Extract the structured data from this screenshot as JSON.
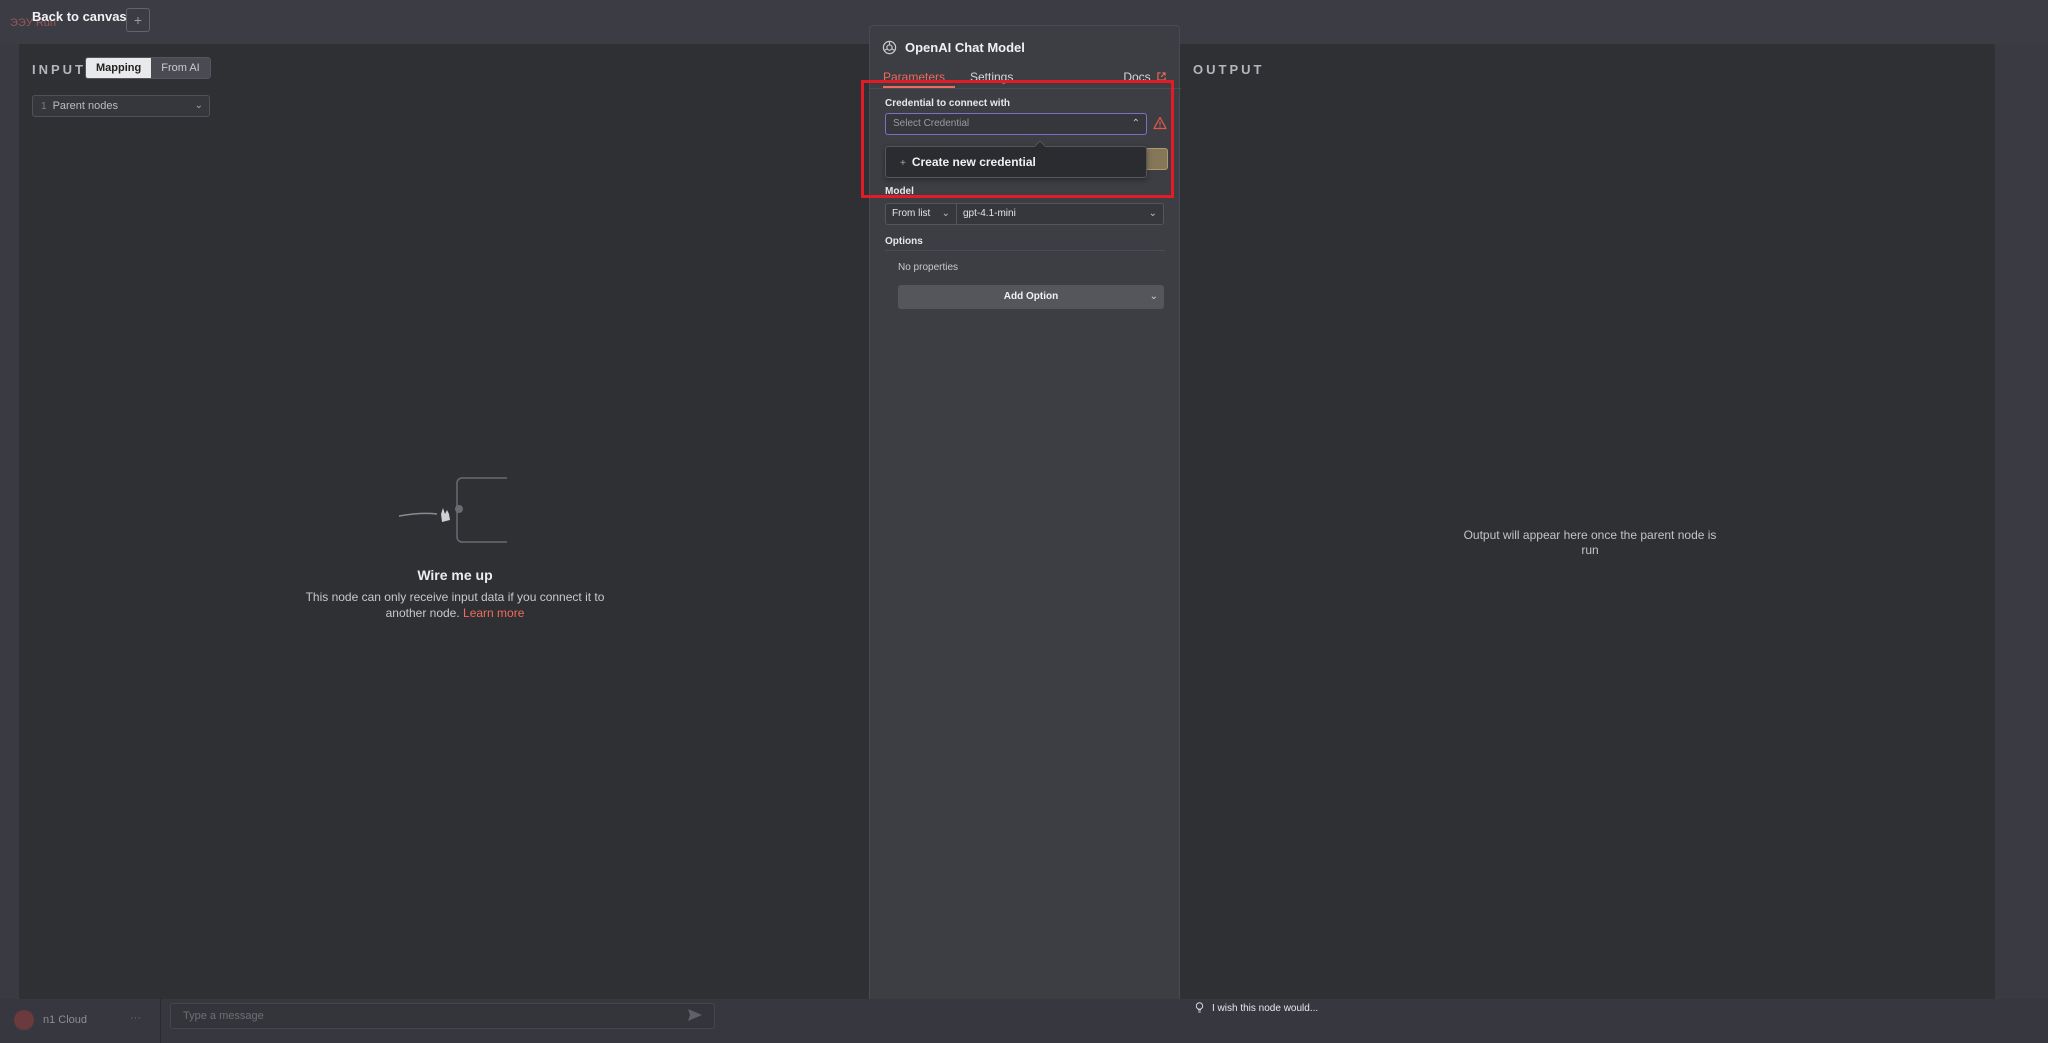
{
  "top": {
    "back_label": "Back to canvas",
    "ghost_text": "ЭЭУ Run",
    "add_symbol": "+"
  },
  "input": {
    "title": "INPUT",
    "toggle": {
      "mapping": "Mapping",
      "from_ai": "From AI"
    },
    "parent_select": "Parent nodes",
    "empty": {
      "title": "Wire me up",
      "description": "This node can only receive input data if you connect it to another node.",
      "learn_more": "Learn more"
    }
  },
  "node": {
    "title": "OpenAI Chat Model",
    "tabs": {
      "parameters": "Parameters",
      "settings": "Settings",
      "docs": "Docs"
    },
    "credential": {
      "label": "Credential to connect with",
      "placeholder": "Select Credential",
      "create_option": "Create new credential"
    },
    "model": {
      "label": "Model",
      "mode": "From list",
      "value": "gpt-4.1-mini"
    },
    "options": {
      "label": "Options",
      "empty_text": "No properties",
      "add_button": "Add Option"
    }
  },
  "output": {
    "title": "OUTPUT",
    "message": "Output will appear here once the parent node is run"
  },
  "bottom": {
    "workspace": "n1 Cloud",
    "chat_placeholder": "Type a message",
    "feedback": "I wish this node would..."
  },
  "colors": {
    "accent": "#ef6b5a",
    "highlight": "#e11c26",
    "focus_border": "#7a70c6"
  }
}
